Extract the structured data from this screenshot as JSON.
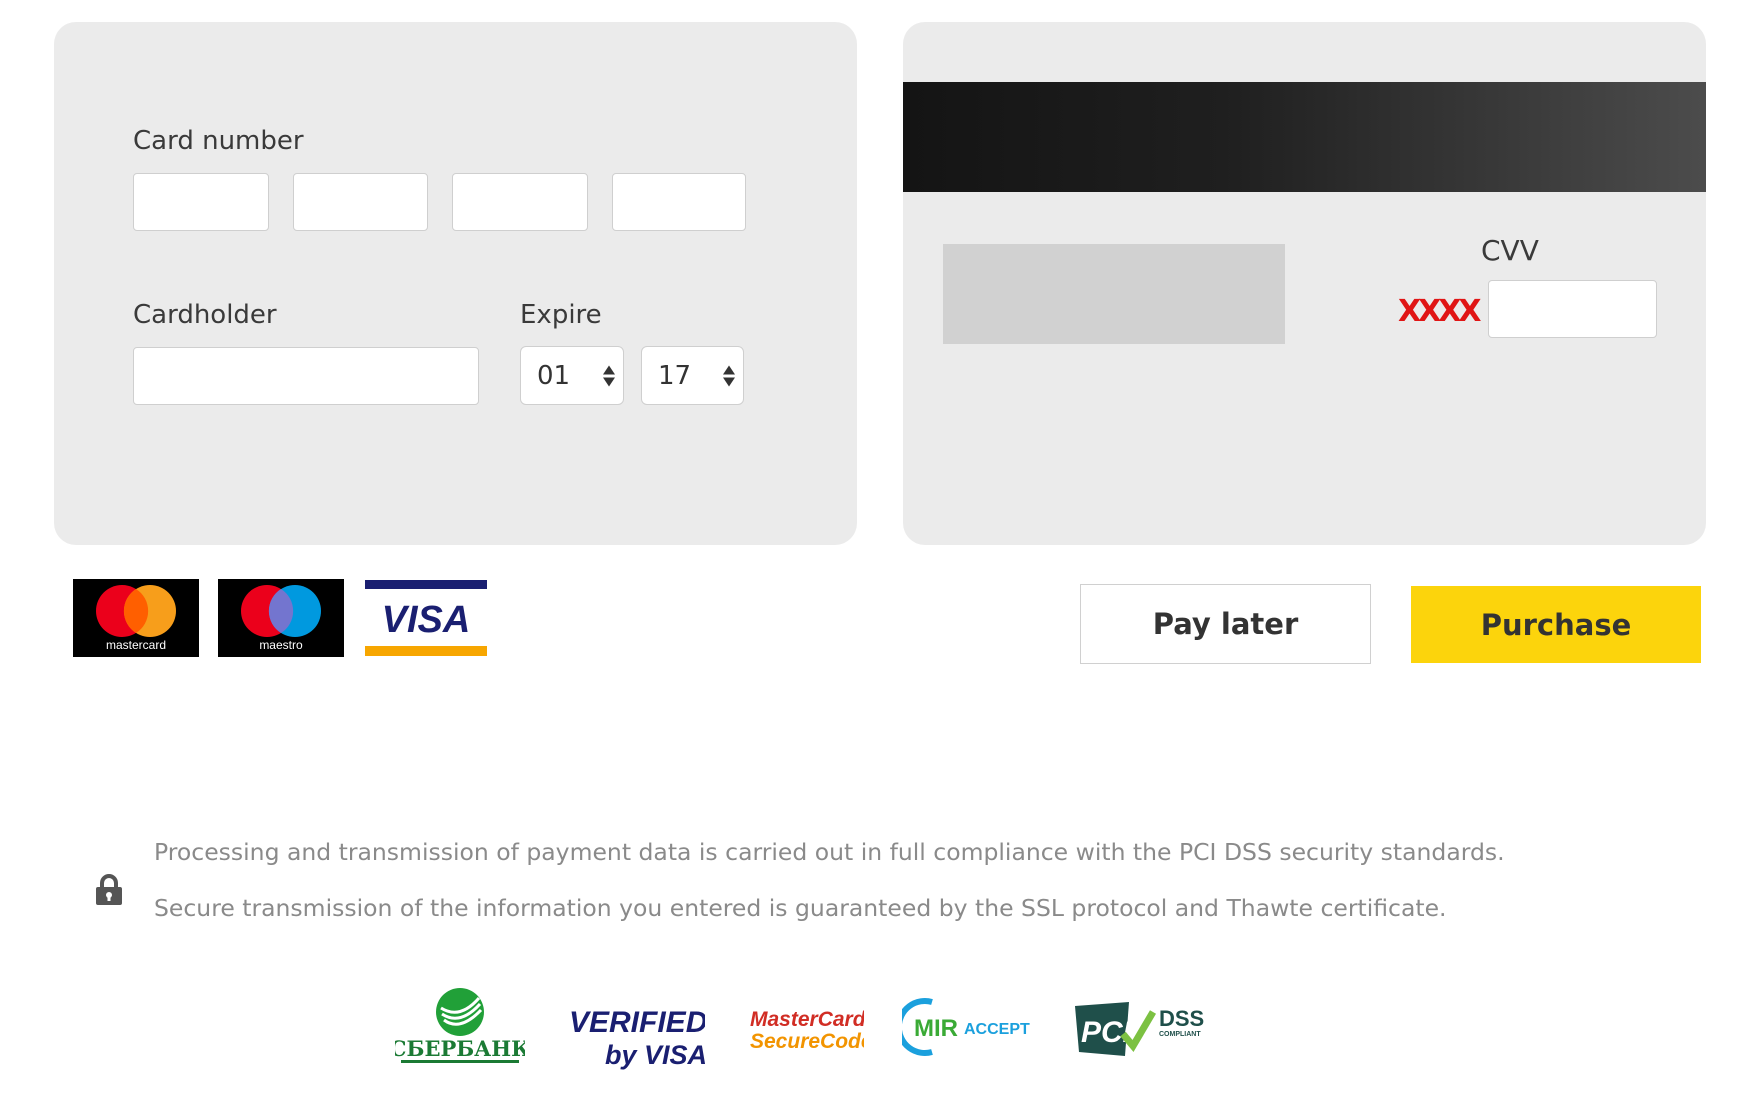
{
  "card_front": {
    "card_number_label": "Card number",
    "cardholder_label": "Cardholder",
    "expire_label": "Expire",
    "expire_month": "01",
    "expire_year": "17"
  },
  "card_back": {
    "cvv_label": "CVV",
    "cvv_hint": "XXXX"
  },
  "card_brands": {
    "mastercard": "mastercard",
    "maestro": "maestro",
    "visa": "VISA"
  },
  "actions": {
    "pay_later_label": "Pay later",
    "purchase_label": "Purchase"
  },
  "security_notes": {
    "line1": "Processing and transmission of payment data is carried out in full compliance with the PCI DSS security standards.",
    "line2": "Secure transmission of the information you entered is guaranteed by the SSL protocol and Thawte certificate."
  },
  "trust_logos": {
    "sberbank": "СБЕРБАНК",
    "verified_1": "VERIFIED",
    "verified_2": "by VISA",
    "mc_secure_1": "MasterCard.",
    "mc_secure_2": "SecureCode.",
    "mir_1": "MIR",
    "mir_2": "ACCEPT",
    "pci_1": "PCI",
    "pci_2": "DSS",
    "pci_3": "COMPLIANT"
  },
  "colors": {
    "panel_bg": "#ebebeb",
    "purchase_bg": "#fcd40c",
    "cvv_hint": "#e01515"
  }
}
